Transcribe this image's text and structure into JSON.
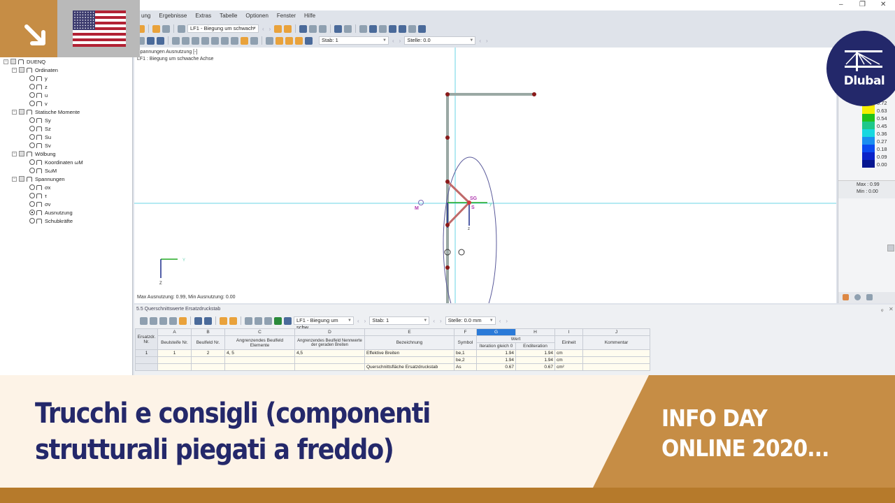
{
  "window": {
    "minimize": "–",
    "restore": "❐",
    "close": "✕"
  },
  "menu": [
    "ung",
    "Ergebnisse",
    "Extras",
    "Tabelle",
    "Optionen",
    "Fenster",
    "Hilfe"
  ],
  "toolbar1": {
    "loadcase": "LF1 - Biegung um schwach"
  },
  "toolbar2": {
    "stab": "Stab: 1",
    "stelle": "Stelle: 0.0"
  },
  "tree": {
    "root": "DUENQ",
    "groups": [
      {
        "label": "Ordinaten",
        "items": [
          "y",
          "z",
          "u",
          "v"
        ]
      },
      {
        "label": "Statische Momente",
        "items": [
          "Sy",
          "Sz",
          "Su",
          "Sv"
        ]
      },
      {
        "label": "Wölbung",
        "items": [
          "Koordinaten ωM",
          "SωM"
        ]
      },
      {
        "label": "Spannungen",
        "items": [
          "σx",
          "τ",
          "σv",
          "Ausnutzung",
          "Schubkräfte"
        ]
      }
    ],
    "selected": "Ausnutzung"
  },
  "canvas": {
    "header1": "Spannungen Ausnutzung [-]",
    "header2": "LF1 : Biegung um schwache Achse",
    "footer": "Max Ausnutzung: 0.99, Min Ausnutzung: 0.00",
    "labels": {
      "M": "M",
      "SG": "SG",
      "S": "S",
      "y": "y",
      "z": "z",
      "Y": "Y",
      "Z": "Z"
    }
  },
  "legend": {
    "values": [
      "0.72",
      "0.63",
      "0.54",
      "0.45",
      "0.36",
      "0.27",
      "0.18",
      "0.09",
      "0.00"
    ],
    "colors": [
      "#d8c21a",
      "#f5ee00",
      "#22c21a",
      "#1ec88a",
      "#18d8e0",
      "#1a8ef0",
      "#0a4af0",
      "#0a22c8",
      "#061690"
    ],
    "max": "Max  :  0.99",
    "min": "Min  :  0.00"
  },
  "table_panel": {
    "title": "5.5 Querschnittswerte Ersatzdruckstab",
    "loadcase": "LF1 - Biegung um schw",
    "stab": "Stab: 1",
    "stelle": "Stelle: 0.0 mm",
    "pin": "ᵩ",
    "close": "✕",
    "columns_letters": [
      "A",
      "B",
      "C",
      "D",
      "E",
      "F",
      "G",
      "H",
      "I",
      "J"
    ],
    "row_header": "Ersatzdr. Nr.",
    "headers": [
      "Beulsteife Nr.",
      "Beulfeld Nr.",
      "Angrenzendes Beulfeld Elemente",
      "Angrenzendes Beulfeld Nennwerte der geraden Breiten",
      "Bezeichnung",
      "Symbol",
      "Iteration gleich 0",
      "Enditeration",
      "Einheit",
      "Kommentar"
    ],
    "wert": "Wert",
    "rows": [
      {
        "nr": "1",
        "a": "1",
        "b": "2",
        "c": "4, 5",
        "d": "4,5",
        "e": "Effektive Breiten",
        "f": "be,1",
        "g": "1.94",
        "h": "1.94",
        "i": "cm",
        "j": ""
      },
      {
        "nr": "",
        "a": "",
        "b": "",
        "c": "",
        "d": "",
        "e": "",
        "f": "be,2",
        "g": "1.94",
        "h": "1.94",
        "i": "cm",
        "j": ""
      },
      {
        "nr": "",
        "a": "",
        "b": "",
        "c": "",
        "d": "",
        "e": "Querschnittsfläche Ersatzdruckstab",
        "f": "As",
        "g": "0.67",
        "h": "0.67",
        "i": "cm²",
        "j": ""
      }
    ]
  },
  "banner": {
    "title_line1": "Trucchi e consigli (componenti",
    "title_line2": "strutturali piegati a freddo)",
    "subtitle_line1": "INFO DAY",
    "subtitle_line2": "ONLINE 2020..."
  },
  "logo": {
    "text": "Dlubal"
  }
}
